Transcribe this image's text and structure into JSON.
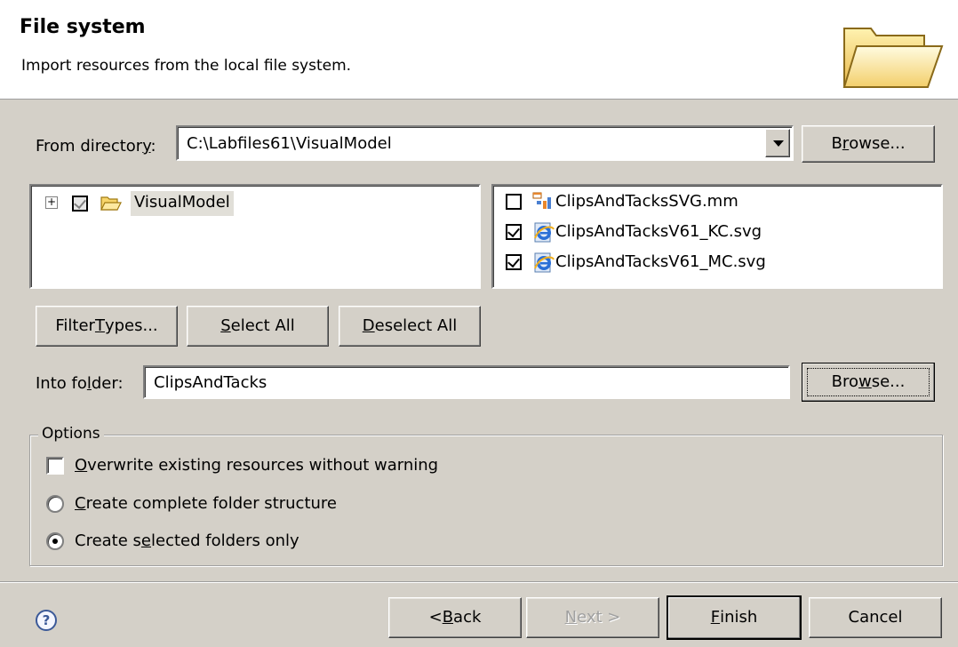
{
  "header": {
    "title": "File system",
    "description": "Import resources from the local file system."
  },
  "from_directory": {
    "label_pre": "From director",
    "label_mnemonic": "y",
    "label_post": ":",
    "value": "C:\\Labfiles61\\VisualModel",
    "browse_pre": "B",
    "browse_mnemonic": "r",
    "browse_post": "owse..."
  },
  "tree": {
    "items": [
      {
        "label": "VisualModel",
        "checked": true,
        "expanded": false
      }
    ]
  },
  "files": {
    "items": [
      {
        "label": "ClipsAndTacksSVG.mm",
        "checked": false,
        "icon": "model-file-icon"
      },
      {
        "label": "ClipsAndTacksV61_KC.svg",
        "checked": true,
        "icon": "ie-document-icon"
      },
      {
        "label": "ClipsAndTacksV61_MC.svg",
        "checked": true,
        "icon": "ie-document-icon"
      }
    ]
  },
  "buttons": {
    "filter_types_pre": "Filter ",
    "filter_types_mnemonic": "T",
    "filter_types_post": "ypes...",
    "select_all_mnemonic": "S",
    "select_all_post": "elect All",
    "deselect_all_mnemonic": "D",
    "deselect_all_post": "eselect All"
  },
  "into_folder": {
    "label_pre": "Into fo",
    "label_mnemonic": "l",
    "label_post": "der:",
    "value": "ClipsAndTacks",
    "browse_pre": "Bro",
    "browse_mnemonic": "w",
    "browse_post": "se..."
  },
  "options": {
    "legend": "Options",
    "overwrite_mnemonic": "O",
    "overwrite_post": "verwrite existing resources without warning",
    "overwrite_checked": false,
    "complete_mnemonic": "C",
    "complete_post": "reate complete folder structure",
    "selected_pre": "Create s",
    "selected_mnemonic": "e",
    "selected_post": "lected folders only",
    "selected_option": "selected"
  },
  "footer": {
    "help": "?",
    "back_pre": "< ",
    "back_mnemonic": "B",
    "back_post": "ack",
    "next_mnemonic": "N",
    "next_post": "ext >",
    "finish_mnemonic": "F",
    "finish_post": "inish",
    "cancel": "Cancel"
  }
}
